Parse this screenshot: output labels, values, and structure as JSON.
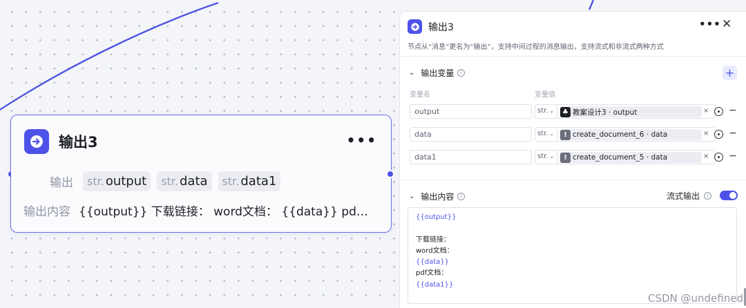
{
  "node": {
    "title": "输出3",
    "more": "•••",
    "output_label": "输出",
    "outputs": [
      {
        "type": "str.",
        "name": "output"
      },
      {
        "type": "str.",
        "name": "data"
      },
      {
        "type": "str.",
        "name": "data1"
      }
    ],
    "content_label": "输出内容",
    "content_preview": "{{output}} 下载链接： word文档： {{data}} pd…"
  },
  "panel": {
    "title": "输出3",
    "more": "•••",
    "close": "✕",
    "description": "节点从“消息”更名为“输出”，支持中间过程的消息输出，支持流式和非流式两种方式",
    "vars_section": {
      "title": "输出变量",
      "add": "+",
      "col_name": "变量名",
      "col_value": "变量值",
      "rows": [
        {
          "name": "output",
          "type": "str.",
          "ref": "教案设计3 · output",
          "ref_icon": "doc-node-icon",
          "ref_color": "#1c1f23"
        },
        {
          "name": "data",
          "type": "str.",
          "ref": "create_document_6 · data",
          "ref_icon": "plugin-node-icon",
          "ref_color": "#6b6f7b"
        },
        {
          "name": "data1",
          "type": "str.",
          "ref": "create_document_5 · data",
          "ref_icon": "plugin-node-icon",
          "ref_color": "#6b6f7b"
        }
      ]
    },
    "content_section": {
      "title": "输出内容",
      "stream_label": "流式输出",
      "stream_enabled": true,
      "lines": [
        {
          "text": "{{output}}",
          "kind": "var"
        },
        {
          "text": "",
          "kind": "plain"
        },
        {
          "text": "下载链接：",
          "kind": "plain"
        },
        {
          "text": "word文档：",
          "kind": "plain"
        },
        {
          "text": "{{data}}",
          "kind": "var"
        },
        {
          "text": "pdf文档：",
          "kind": "plain"
        },
        {
          "text": "{{data1}}",
          "kind": "var"
        }
      ]
    }
  },
  "watermark": "CSDN @undefined",
  "colors": {
    "accent": "#4d53e8",
    "edge": "#5055e0"
  }
}
